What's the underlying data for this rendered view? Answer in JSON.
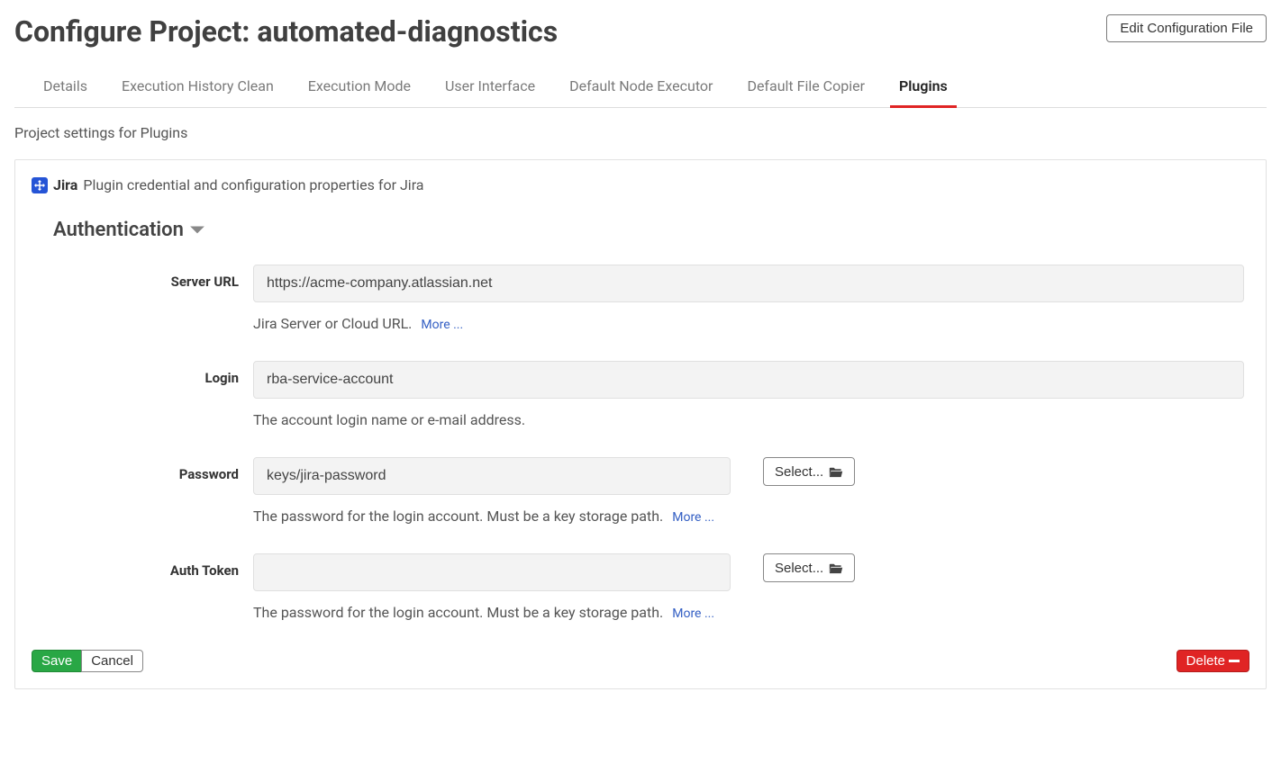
{
  "header": {
    "title": "Configure Project: automated-diagnostics",
    "edit_button": "Edit Configuration File"
  },
  "tabs": [
    {
      "label": "Details",
      "active": false
    },
    {
      "label": "Execution History Clean",
      "active": false
    },
    {
      "label": "Execution Mode",
      "active": false
    },
    {
      "label": "User Interface",
      "active": false
    },
    {
      "label": "Default Node Executor",
      "active": false
    },
    {
      "label": "Default File Copier",
      "active": false
    },
    {
      "label": "Plugins",
      "active": true
    }
  ],
  "settings_desc": "Project settings for Plugins",
  "plugin": {
    "name": "Jira",
    "description": "Plugin credential and configuration properties for Jira"
  },
  "section": {
    "title": "Authentication"
  },
  "fields": {
    "server_url": {
      "label": "Server URL",
      "value": "https://acme-company.atlassian.net",
      "help": "Jira Server or Cloud URL.",
      "more": "More ..."
    },
    "login": {
      "label": "Login",
      "value": "rba-service-account",
      "help": "The account login name or e-mail address."
    },
    "password": {
      "label": "Password",
      "value": "keys/jira-password",
      "select_label": "Select...",
      "help": "The password for the login account. Must be a key storage path.",
      "more": "More ..."
    },
    "auth_token": {
      "label": "Auth Token",
      "value": "",
      "select_label": "Select...",
      "help": "The password for the login account. Must be a key storage path.",
      "more": "More ..."
    }
  },
  "footer": {
    "save": "Save",
    "cancel": "Cancel",
    "delete": "Delete"
  }
}
